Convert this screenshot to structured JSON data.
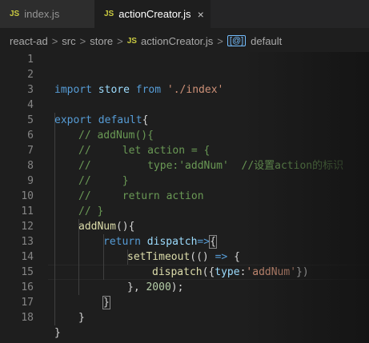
{
  "tabs": [
    {
      "label": "index.js",
      "icon": "JS"
    },
    {
      "label": "actionCreator.js",
      "icon": "JS",
      "close": "×"
    }
  ],
  "breadcrumb": {
    "items": [
      "react-ad",
      "src",
      "store"
    ],
    "file_icon": "JS",
    "file": "actionCreator.js",
    "symbol_icon": "[@]",
    "symbol": "default",
    "separator": ">"
  },
  "line_numbers": [
    "1",
    "2",
    "3",
    "4",
    "5",
    "6",
    "7",
    "8",
    "9",
    "10",
    "11",
    "12",
    "13",
    "14",
    "15",
    "16",
    "17",
    "18"
  ],
  "code": {
    "l2": {
      "k1": "import",
      "v1": "store",
      "k2": "from",
      "s1": "'./index'"
    },
    "l4": {
      "k1": "export",
      "k2": "default",
      "p": "{"
    },
    "l5": "// addNum(){",
    "l6": "//     let action = {",
    "l7": "//         type:'addNum'  //设置action的标识",
    "l8": "//     }",
    "l9": "//     return action",
    "l10": "// }",
    "l11": {
      "f": "addNum",
      "p": "(){"
    },
    "l12": {
      "k": "return",
      "v": "dispatch",
      "a": "=>",
      "b": "{"
    },
    "l13": {
      "f": "setTimeout",
      "p1": "(() ",
      "a": "=>",
      "p2": " {"
    },
    "l14": {
      "f": "dispatch",
      "p1": "({",
      "v": "type",
      "c": ":",
      "s": "'addNum'",
      "p2": "})"
    },
    "l15": {
      "p1": "}, ",
      "n": "2000",
      "p2": ");"
    },
    "l16": "}",
    "l17": "}",
    "l18": "}"
  },
  "colors": {
    "keyword": "#569cd6",
    "function": "#dcdcaa",
    "variable": "#9cdcfe",
    "string": "#ce9178",
    "number": "#b5cea8",
    "comment": "#6a9955",
    "js_icon": "#cbcb41"
  }
}
